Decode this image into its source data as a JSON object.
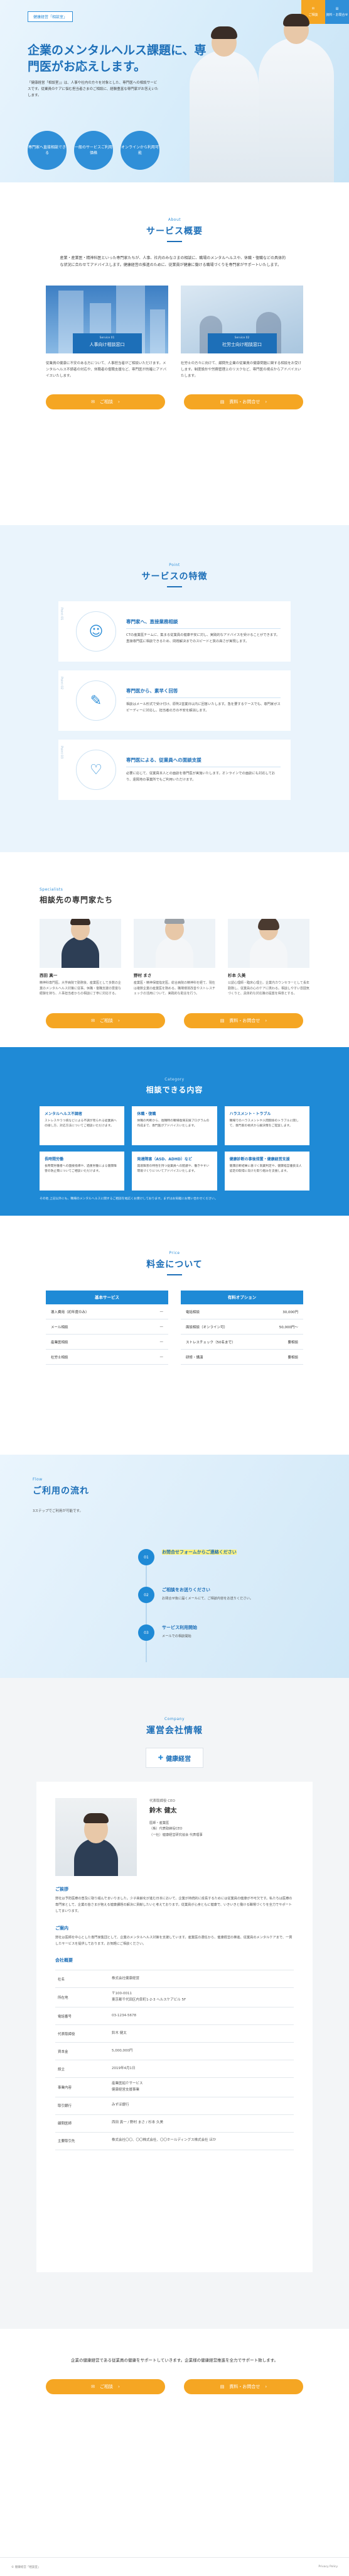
{
  "header": {
    "logo": "健康経営「相談室」",
    "btn_contact": "ご相談",
    "btn_docs": "資料・お問合せ"
  },
  "hero": {
    "title": "企業のメンタルヘルス課題に、専門医がお応えします。",
    "lead": "「健康経営「相談室」」は、人事や社内の方々を対象とした、専門医への相談サービスです。従業員のケアに悩む担当者さまのご相談に、経験豊富な専門家がお答えいたします。",
    "circles": [
      "専門家へ直接相談できる",
      "一般のサービスご利用価格",
      "オンラインから利用可能"
    ]
  },
  "overview": {
    "eyebrow": "About",
    "title": "サービス概要",
    "text": "産業・産業医・精神科医といった専門家たちが、人事、社内のみなさまの相談に、職場のメンタルヘルスや、休職・復職などの具体的な状況に合わせてアドバイスします。健康経営の推進のために、従業員が健康に働ける職場づくりを専門家がサポートいたします。",
    "cards": [
      {
        "en": "Service 01",
        "jp": "人事向け相談窓口",
        "desc": "従業員の健康に不安のある方について、人事担当者がご相談いただけます。メンタルヘルス不調者の対応や、休職者の復職支援など、専門医が的確にアドバイスいたします。"
      },
      {
        "en": "Service 02",
        "jp": "社労士向け相談窓口",
        "desc": "社労士の方々に向けて、顧問先企業の従業員の健康問題に関する相談をお受けします。制度設計や労務管理上のリスクなど、専門医の視点からアドバイスいたします。"
      }
    ],
    "btn_contact": "ご相談",
    "btn_docs": "資料・お問合せ"
  },
  "features": {
    "eyebrow": "Point",
    "title": "サービスの特徴",
    "items": [
      {
        "point": "Point 01",
        "title": "専門家へ、直接業務相談",
        "desc": "CTの産業医チームに、集まる従業員の健康不安に対し、実践的なアドバイスを受けることができます。直接専門医に相談できるため、問題解決までのスピードと質の高さが実現します。"
      },
      {
        "point": "Point 02",
        "title": "専門医から、素早く回答",
        "desc": "相談はメール形式で受け付け、原則2営業日以内に回答いたします。急を要するケースでも、専門家がスピーディーに対応し、担当者の方の不安を解消します。"
      },
      {
        "point": "Point 03",
        "title": "専門医による、従業員への面談支援",
        "desc": "必要に応じて、従業員本人との面談を専門医が実施いたします。オンラインでの面談にも対応しており、遠隔地の事業所でもご利用いただけます。"
      }
    ]
  },
  "specialists": {
    "eyebrow": "Specialists",
    "title": "相談先の専門家たち",
    "people": [
      {
        "name": "西田 真一",
        "bio": "精神科専門医。大学病院で勤務後、産業医として多数の企業のメンタルヘルス対策に従事。休職・復職支援の豊富な経験を持ち、人事担当者からの相談に丁寧に対応する。"
      },
      {
        "name": "野村 まさ",
        "bio": "産業医・精神保健指定医。総合病院の精神科を経て、現在は複数企業の産業医を務める。職場環境改善やストレスチェックの活用について、実践的な助言を行う。"
      },
      {
        "name": "杉本 久美",
        "bio": "公認心理師・臨床心理士。企業内カウンセラーとして長年勤務し、従業員の心のケアに携わる。相談しやすい雰囲気づくりと、具体的な対応策の提案を得意とする。"
      }
    ],
    "btn_contact": "ご相談",
    "btn_docs": "資料・お問合せ"
  },
  "consult": {
    "eyebrow": "Category",
    "title": "相談できる内容",
    "items": [
      {
        "title": "メンタルヘルス不調者",
        "desc": "ストレスやうつ病などによる不調が見られる従業員への接し方、対応方法についてご相談いただけます。"
      },
      {
        "title": "休職・復職",
        "desc": "休職の判断から、復職時の職場復帰支援プログラムの作成まで、専門医がアドバイスいたします。"
      },
      {
        "title": "ハラスメント・トラブル",
        "desc": "職場でのハラスメントや人間関係のトラブルに関して、専門家の視点から解決策をご提案します。"
      },
      {
        "title": "長時間労働",
        "desc": "長時間労働者への面接指導や、過重労働による健康障害の防止策についてご相談いただけます。"
      },
      {
        "title": "発達障害（ASD、ADHD）など",
        "desc": "発達障害の特性を持つ従業員への配慮や、働きやすい環境づくりについてアドバイスいたします。"
      },
      {
        "title": "健康診断の事後措置・健康経営支援",
        "desc": "健康診断結果に基づく就業判定や、健康経営優良法人認定の取得に向けた取り組みを支援します。"
      }
    ],
    "note": "その他 上記以外にも、職場のメンタルヘルスに関するご相談を幅広くお受けしております。まずはお気軽にお問い合わせください。"
  },
  "pricing": {
    "eyebrow": "Price",
    "title": "料金について",
    "basic": {
      "head": "基本サービス",
      "rows": [
        [
          "導入費用（初年度のみ）",
          "—"
        ],
        [
          "メール相談",
          "—"
        ],
        [
          "産業医相談",
          "—"
        ],
        [
          "社労士相談",
          "—"
        ]
      ]
    },
    "option": {
      "head": "有料オプション",
      "rows": [
        [
          "電話相談",
          "30,000円"
        ],
        [
          "面談相談（オンライン可）",
          "50,000円〜"
        ],
        [
          "ストレスチェック（50名まで）",
          "要相談"
        ],
        [
          "研修・講演",
          "要相談"
        ]
      ]
    }
  },
  "flow": {
    "eyebrow": "Flow",
    "title": "ご利用の流れ",
    "note": "3ステップでご利用が可能です。",
    "steps": [
      {
        "num": "01",
        "title": "お問合せフォームからご連絡ください",
        "desc": ""
      },
      {
        "num": "02",
        "title": "ご相談をお送りください",
        "desc": "お問合せ後に届くメールにて、ご相談内容をお送りください。"
      },
      {
        "num": "03",
        "title": "サービス利用開始",
        "desc": "メールでの相談開始"
      }
    ]
  },
  "company": {
    "eyebrow": "Company",
    "title": "運営会社情報",
    "logo": "健康経営",
    "ceo_role": "代表取締役 CEO",
    "ceo_name": "鈴木 健太",
    "ceo_career": "医師・産業医\n（株）代表取締役CEO\n（一社）健康経営研究協会 代表理事",
    "greeting_title": "ご挨拶",
    "greeting": "弊社は予防医療の普及に取り組んでまいりました。少子高齢化が進む日本において、企業が持続的に成長するためには従業員の健康が不可欠です。私たちは医療の専門家として、企業の皆さまが抱える健康課題の解決に貢献したいと考えております。従業員が心身ともに健康で、いきいきと働ける職場づくりを全力でサポートしてまいります。",
    "vision_title": "ご案内",
    "vision": "弊社は医師を中心とした専門家集団として、企業のメンタルヘルス対策を支援しています。産業医の選任から、健康経営の推進、従業員のメンタルケアまで、一貫したサービスを提供しております。お気軽にご相談ください。",
    "info_title": "会社概要",
    "rows": [
      [
        "社名",
        "株式会社健康経営"
      ],
      [
        "所在地",
        "〒100-0011\n東京都千代田区内幸町1-2-3 ヘルスケアビル 5F"
      ],
      [
        "電話番号",
        "03-1234-5678"
      ],
      [
        "代表取締役",
        "鈴木 健太"
      ],
      [
        "資本金",
        "5,000,000円"
      ],
      [
        "設立",
        "2019年4月1日"
      ],
      [
        "事業内容",
        "産業医紹介サービス\n健康経営支援事業"
      ],
      [
        "取引銀行",
        "みずほ銀行"
      ],
      [
        "顧問医師",
        "西田 真一 / 野村 まさ / 杉本 久美"
      ],
      [
        "主要取引先",
        "株式会社〇〇、〇〇株式会社、〇〇ホールディングス株式会社 ほか"
      ]
    ]
  },
  "cta": {
    "text": "企業の健康経営である従業員の健康をサポートしていきます。企業様の健康経営推進を全力でサポート致します。",
    "btn_contact": "ご相談",
    "btn_docs": "資料・お問合せ"
  },
  "footer": {
    "copyright": "© 健康経営「相談室」",
    "privacy": "Privacy Policy"
  },
  "colors": {
    "primary": "#1d6fb8",
    "accent": "#f5a623",
    "blue": "#1f8ad6"
  }
}
